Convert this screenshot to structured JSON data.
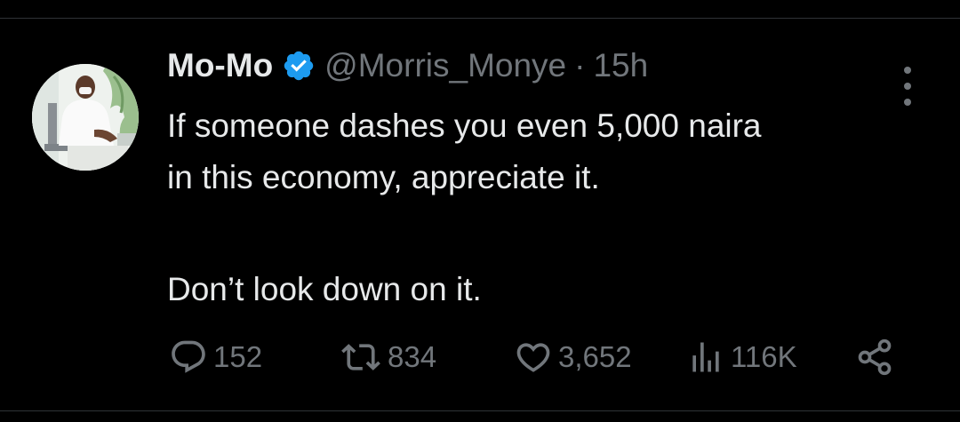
{
  "tweet": {
    "author": {
      "display_name": "Mo-Mo",
      "handle": "@Morris_Monye",
      "verified_icon": "verified-badge-icon",
      "avatar": "profile-photo"
    },
    "separator": "·",
    "time": "15h",
    "text_line_1": "If someone dashes you even 5,000 naira",
    "text_line_2": "in this economy, appreciate it.",
    "text_line_3": "Don’t look down on it.",
    "more_icon": "more-options-icon",
    "actions": {
      "replies": {
        "icon": "reply-icon",
        "count": "152"
      },
      "reposts": {
        "icon": "repost-icon",
        "count": "834"
      },
      "likes": {
        "icon": "heart-icon",
        "count": "3,652"
      },
      "views": {
        "icon": "views-icon",
        "count": "116K"
      },
      "share": {
        "icon": "share-icon"
      }
    }
  },
  "colors": {
    "background": "#000000",
    "primary_text": "#e7e9ea",
    "secondary_text": "#71767b",
    "verified_blue": "#1d9bf0",
    "divider": "#2f3336"
  }
}
